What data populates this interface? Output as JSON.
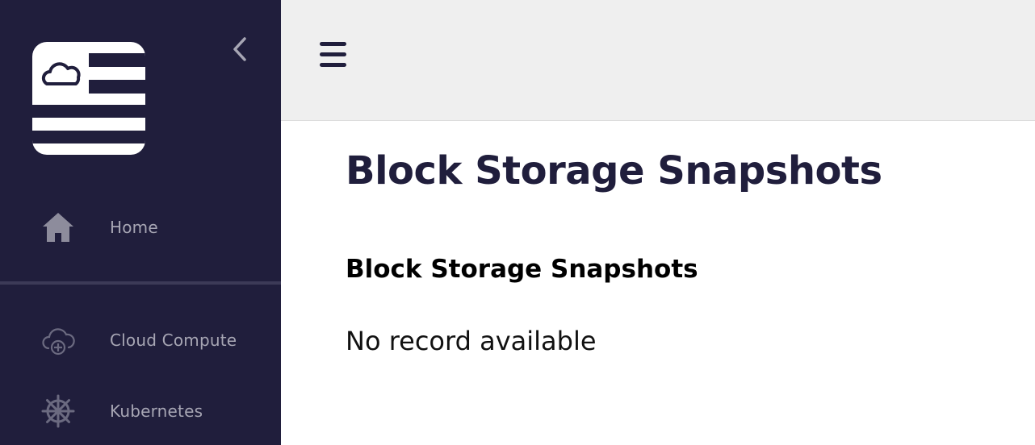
{
  "colors": {
    "sidebar_bg": "#201e3c",
    "topbar_bg": "#efefef",
    "title_color": "#201e3c",
    "nav_text": "#a7a6b4"
  },
  "sidebar": {
    "logo_icon": "cloud-flag-logo",
    "collapse_icon": "chevron-left-icon",
    "items": [
      {
        "label": "Home",
        "icon": "home-icon"
      },
      {
        "label": "Cloud Compute",
        "icon": "cloud-plus-icon"
      },
      {
        "label": "Kubernetes",
        "icon": "helm-wheel-icon"
      }
    ]
  },
  "topbar": {
    "menu_icon": "hamburger-menu-icon"
  },
  "main": {
    "page_title": "Block Storage Snapshots",
    "section_title": "Block Storage Snapshots",
    "empty_message": "No record available"
  }
}
